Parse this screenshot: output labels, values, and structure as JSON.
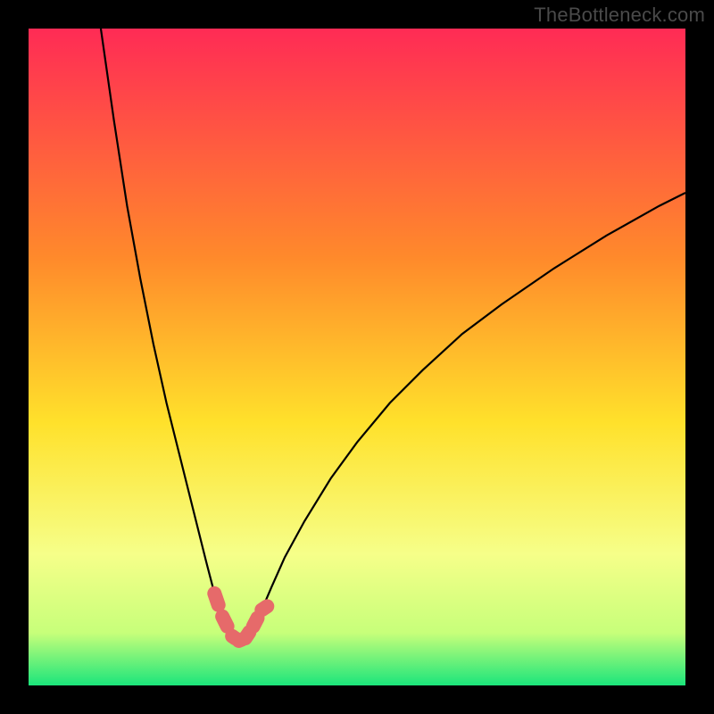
{
  "watermark": "TheBottleneck.com",
  "colors": {
    "bg": "#000000",
    "gradient_top": "#ff2b55",
    "gradient_mid1": "#ff8a2b",
    "gradient_mid2": "#ffe12b",
    "gradient_mid3": "#f6ff89",
    "gradient_low": "#c7ff7a",
    "gradient_bottom": "#1be57b",
    "curve": "#000000",
    "marker_fill": "#e66a6a",
    "marker_stroke": "#d85a5a"
  },
  "chart_data": {
    "type": "line",
    "title": "",
    "xlabel": "",
    "ylabel": "",
    "xlim": [
      0,
      100
    ],
    "ylim": [
      0,
      100
    ],
    "grid": false,
    "legend": false,
    "note": "V-shaped bottleneck curve; minimum near x≈32; background is vertical red→green gradient; pink rounded markers sit on the curve near its bottom around y≈7–11.",
    "series": [
      {
        "name": "curve",
        "x": [
          11,
          13,
          15,
          17,
          19,
          21,
          23,
          25,
          27,
          28.3,
          29.5,
          31,
          32,
          33,
          34.2,
          35.5,
          37,
          39,
          42,
          46,
          50,
          55,
          60,
          66,
          72,
          80,
          88,
          96,
          100
        ],
        "y": [
          100,
          86,
          73,
          62,
          52,
          43,
          35,
          27,
          19,
          14,
          10.5,
          7.5,
          6.8,
          7.2,
          9,
          11.5,
          15,
          19.5,
          25,
          31.5,
          37,
          43,
          48,
          53.5,
          58,
          63.5,
          68.5,
          73,
          75
        ]
      }
    ],
    "markers": [
      {
        "x": 28.3,
        "y": 14.0
      },
      {
        "x": 29.5,
        "y": 10.5
      },
      {
        "x": 31.0,
        "y": 7.5
      },
      {
        "x": 32.0,
        "y": 6.8
      },
      {
        "x": 33.0,
        "y": 7.2
      },
      {
        "x": 34.2,
        "y": 9.0
      },
      {
        "x": 35.5,
        "y": 11.5
      }
    ]
  }
}
